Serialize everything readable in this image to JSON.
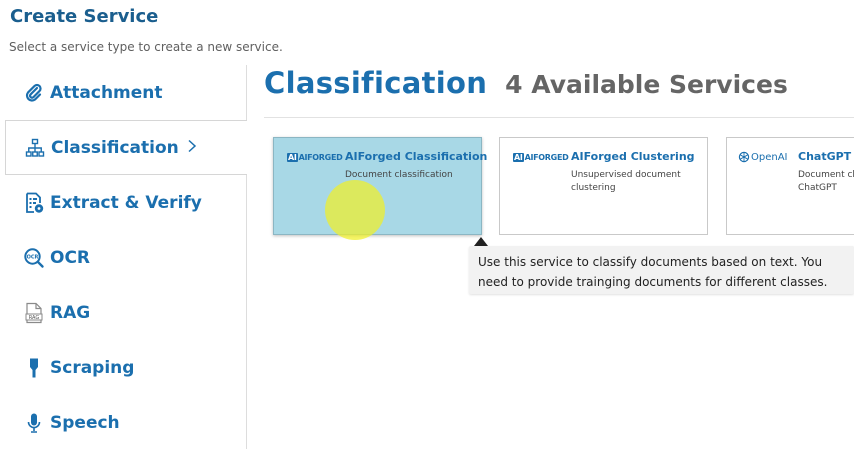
{
  "header": {
    "title": "Create Service",
    "subtitle": "Select a service type to create a new service."
  },
  "sidebar": {
    "items": [
      {
        "label": "Attachment",
        "icon": "paperclip-icon"
      },
      {
        "label": "Classification",
        "icon": "hierarchy-icon",
        "active": true
      },
      {
        "label": "Extract & Verify",
        "icon": "document-gear-icon"
      },
      {
        "label": "OCR",
        "icon": "ocr-magnifier-icon"
      },
      {
        "label": "RAG",
        "icon": "rag-file-icon"
      },
      {
        "label": "Scraping",
        "icon": "scraper-icon"
      },
      {
        "label": "Speech",
        "icon": "microphone-icon"
      }
    ]
  },
  "main": {
    "title": "Classification",
    "available_count": "4 Available Services"
  },
  "services": [
    {
      "logo_text": "AIFORGED",
      "name": "AIForged Classification",
      "description": "Document classification",
      "selected": true
    },
    {
      "logo_text": "AIFORGED",
      "name": "AIForged Clustering",
      "description": "Unsupervised document clustering"
    },
    {
      "logo_text": "OpenAI",
      "name": "ChatGPT Cl",
      "description": "Document cl ChatGPT"
    }
  ],
  "tooltip": {
    "text": "Use this service to classify documents based on text. You need to provide trainging documents for different classes."
  },
  "colors": {
    "accent": "#1b6fae",
    "selected_card": "#a8d8e6",
    "tooltip_bg": "#f2f2f2"
  }
}
